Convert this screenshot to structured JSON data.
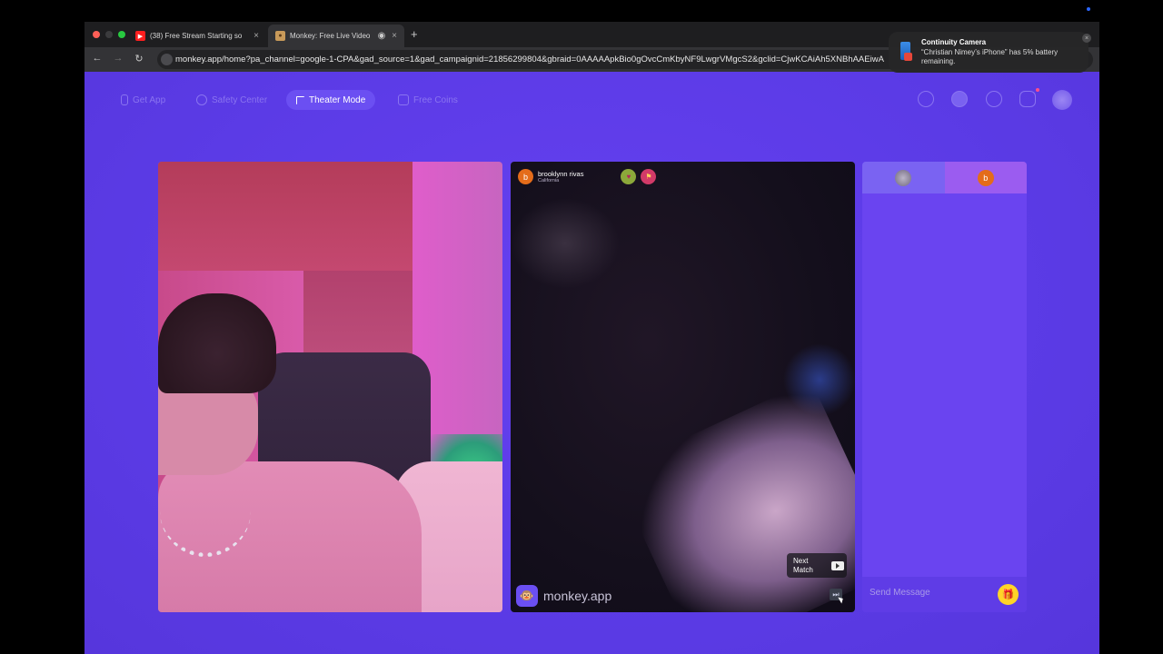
{
  "browser": {
    "tabs": [
      {
        "title": "(38) Free Stream Starting so",
        "favicon": "youtube-icon",
        "active": false
      },
      {
        "title": "Monkey: Free Live Video",
        "favicon": "monkey-icon",
        "active": true
      }
    ],
    "close_glyph": "×",
    "new_tab_glyph": "+",
    "url": "monkey.app/home?pa_channel=google-1-CPA&gad_source=1&gad_campaignid=21856299804&gbraid=0AAAAApkBio0gOvcCmKbyNF9LwgrVMgcS2&gclid=CjwKCAiAh5XNBhAAEiwA"
  },
  "nav": {
    "items": [
      {
        "label": "Get App",
        "icon": "phone-icon",
        "active": false
      },
      {
        "label": "Safety Center",
        "icon": "shield-icon",
        "active": false
      },
      {
        "label": "Theater Mode",
        "icon": "expand-icon",
        "active": true
      },
      {
        "label": "Free Coins",
        "icon": "store-icon",
        "active": false
      }
    ],
    "right_icons": [
      "search-icon",
      "crown-icon",
      "history-icon",
      "messages-icon",
      "avatar"
    ]
  },
  "partner": {
    "avatar_letter": "b",
    "name": "brooklynn rivas",
    "location": "California",
    "badges": [
      "heart-badge-icon",
      "flag-badge-icon"
    ]
  },
  "watermark": {
    "text": "monkey.app",
    "logo": "🐵"
  },
  "next_match": {
    "label": "Next Match",
    "key_icon": "arrow-key-icon"
  },
  "skip": {
    "glyph": "⏭"
  },
  "chat": {
    "partner_letter": "b",
    "placeholder": "Send Message",
    "gift_glyph": "🎁"
  },
  "notification": {
    "title": "Continuity Camera",
    "body": "“Christian Nimey’s iPhone” has 5% battery remaining.",
    "close_glyph": "×",
    "battery_percent": 5
  },
  "colors": {
    "page_bg": "#5b3be6",
    "accent": "#6b4ff2",
    "gift": "#ffd428",
    "partner_avatar": "#e46c1a"
  }
}
